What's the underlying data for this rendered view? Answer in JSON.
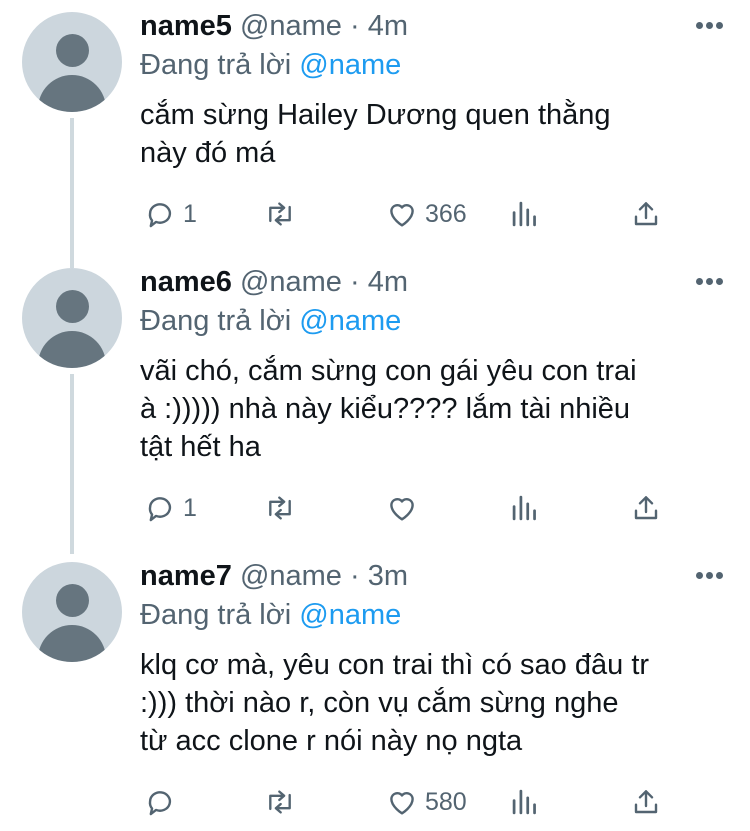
{
  "replies": [
    {
      "name": "name5",
      "handle": "@name",
      "dot": "·",
      "time": "4m",
      "reply_prefix": "Đang trả lời",
      "reply_to": "@name",
      "text_lines": [
        "cắm sừng Hailey Dương quen thằng",
        "này đó má"
      ],
      "replies_count": "1",
      "retweets_count": "",
      "likes_count": "366"
    },
    {
      "name": "name6",
      "handle": "@name",
      "dot": "·",
      "time": "4m",
      "reply_prefix": "Đang trả lời",
      "reply_to": "@name",
      "text_lines": [
        "vãi chó, cắm sừng con gái yêu con trai",
        "à :))))) nhà này kiểu???? lắm tài nhiều",
        "tật hết ha"
      ],
      "replies_count": "1",
      "retweets_count": "",
      "likes_count": ""
    },
    {
      "name": "name7",
      "handle": "@name",
      "dot": "·",
      "time": "3m",
      "reply_prefix": "Đang trả lời",
      "reply_to": "@name",
      "text_lines": [
        "klq cơ mà, yêu con trai thì có sao đâu tr",
        ":))) thời nào r, còn vụ cắm sừng nghe",
        "từ acc clone r nói này nọ ngta"
      ],
      "replies_count": "",
      "retweets_count": "",
      "likes_count": "580"
    }
  ],
  "icons": {
    "reply": "comment-icon",
    "retweet": "retweet-icon",
    "like": "heart-icon",
    "views": "analytics-icon",
    "share": "share-icon",
    "more": "more-icon"
  },
  "colors": {
    "text": "#0f1419",
    "muted": "#536471",
    "mention": "#1d9bf0",
    "avatar_bg": "#ccd6dd",
    "avatar_fg": "#66757f",
    "thread_line": "#cfd9de"
  }
}
